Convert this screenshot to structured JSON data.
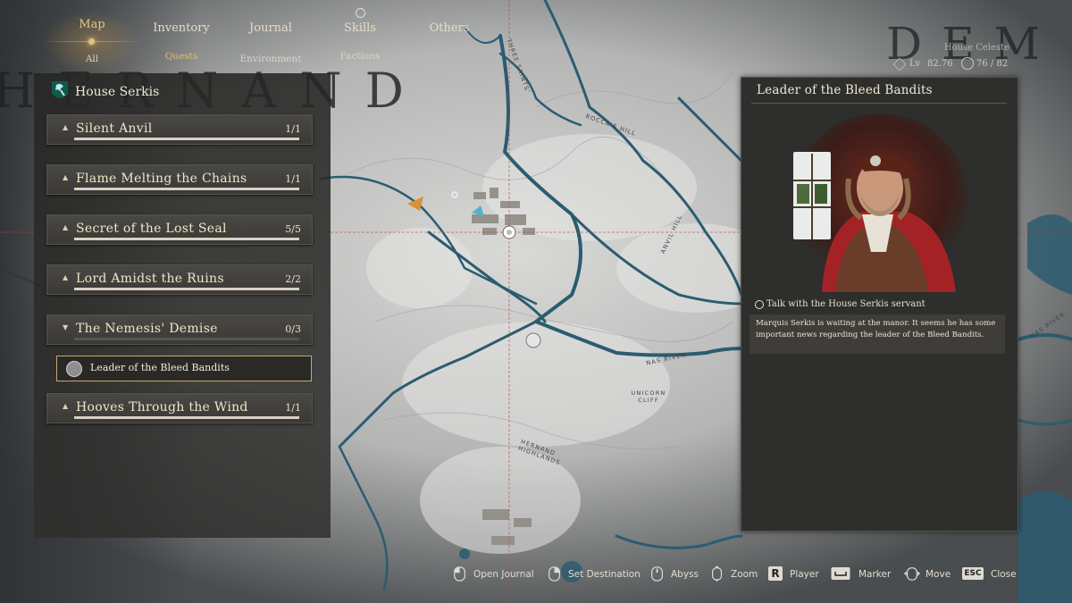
{
  "nav": {
    "tabs": [
      {
        "label": "Map",
        "active": true
      },
      {
        "label": "Inventory",
        "active": false
      },
      {
        "label": "Journal",
        "active": false
      },
      {
        "label": "Skills",
        "active": false
      },
      {
        "label": "Others",
        "active": false
      }
    ],
    "subtabs": [
      {
        "label": "All"
      },
      {
        "label": "Quests",
        "active": true
      },
      {
        "label": "Environment"
      },
      {
        "label": "Factions"
      }
    ]
  },
  "region_letters": "HERNAND",
  "region_letters_right": "DEM",
  "player": {
    "faction": "House Celeste",
    "level_label": "Lv",
    "level": "82.76",
    "capacity": "76 / 82"
  },
  "quest_panel": {
    "house": "House Serkis",
    "quests": [
      {
        "title": "Silent Anvil",
        "progress": "1/1",
        "expanded": false
      },
      {
        "title": "Flame Melting the Chains",
        "progress": "1/1",
        "expanded": false
      },
      {
        "title": "Secret of the Lost Seal",
        "progress": "5/5",
        "expanded": false
      },
      {
        "title": "Lord Amidst the Ruins",
        "progress": "2/2",
        "expanded": false
      },
      {
        "title": "The Nemesis' Demise",
        "progress": "0/3",
        "expanded": true
      },
      {
        "title": "Hooves Through the Wind",
        "progress": "1/1",
        "expanded": false
      }
    ],
    "selected_subquest": "Leader of the Bleed Bandits"
  },
  "detail_panel": {
    "title": "Leader of the Bleed Bandits",
    "objective": "Talk with the House Serkis servant",
    "description": "Marquis Serkis is waiting at the manor. It seems he has some important news regarding the leader of the Bleed Bandits."
  },
  "map_labels": [
    "THREE SAINTS'",
    "ROCCA'S HILL",
    "ANVIL HILL",
    "NAS RIVER",
    "UNICORN CLIFF",
    "HERNAND HIGHLANDS",
    "NAS RIVER"
  ],
  "controls": [
    {
      "icon": "mouse-left-icon",
      "label": "Open Journal"
    },
    {
      "icon": "mouse-right-icon",
      "label": "Set Destination"
    },
    {
      "icon": "mouse-middle-icon",
      "label": "Abyss"
    },
    {
      "icon": "mouse-wheel-icon",
      "label": "Zoom"
    },
    {
      "key": "R",
      "label": "Player"
    },
    {
      "key": "space-key",
      "label": "Marker"
    },
    {
      "icon": "mouse-move-icon",
      "label": "Move"
    },
    {
      "key": "ESC",
      "label": "Close"
    }
  ],
  "colors": {
    "accent_gold": "#e0bd6f",
    "river": "#2b5c70",
    "panel": "#2e2e2c"
  }
}
